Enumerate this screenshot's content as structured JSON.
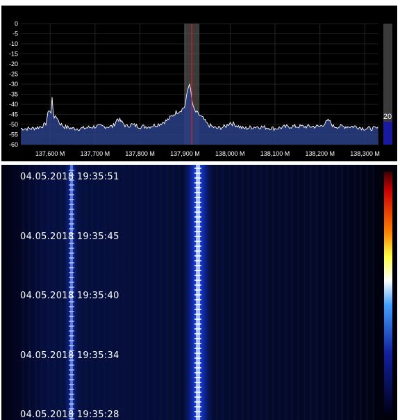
{
  "spectrum": {
    "y_axis_labels": [
      "0",
      "-5",
      "-10",
      "-15",
      "-20",
      "-25",
      "-30",
      "-35",
      "-40",
      "-45",
      "-50",
      "-55",
      "-60"
    ],
    "x_axis_labels": [
      "137,600 M",
      "137,700 M",
      "137,800 M",
      "137,900 M",
      "138,000 M",
      "138,100 M",
      "138,200 M",
      "138,300 M"
    ],
    "side_gain_value": "20",
    "colors": {
      "trace": "#ffffff",
      "fill": "#2a3f86",
      "marker": "#e02020",
      "bandwidth": "#6a6a6a",
      "grid": "#3c3c3c",
      "gain_bar": "#1a1aa0"
    }
  },
  "chart_data": {
    "type": "line",
    "title": "",
    "xlabel": "",
    "ylabel": "",
    "x_unit": "MHz",
    "xlim": [
      137.535,
      138.33
    ],
    "ylim": [
      -60,
      0
    ],
    "grid": true,
    "series": [
      {
        "x": [
          137.54,
          137.56,
          137.58,
          137.59,
          137.598,
          137.602,
          137.605,
          137.607,
          137.61,
          137.615,
          137.62,
          137.63,
          137.65,
          137.67,
          137.7,
          137.72,
          137.74,
          137.75,
          137.77,
          137.78,
          137.8,
          137.82,
          137.84,
          137.86,
          137.87,
          137.88,
          137.89,
          137.9,
          137.905,
          137.91,
          137.915,
          137.92,
          137.93,
          137.94,
          137.95,
          137.97,
          137.99,
          138.0,
          138.03,
          138.06,
          138.1,
          138.13,
          138.16,
          138.2,
          138.22,
          138.23,
          138.25,
          138.28,
          138.3,
          138.32
        ],
        "values": [
          -52,
          -52,
          -51,
          -50,
          -42,
          -45,
          -35,
          -44,
          -47,
          -46,
          -49,
          -51,
          -52,
          -52,
          -51,
          -51,
          -51,
          -47,
          -51,
          -50,
          -51,
          -51,
          -50,
          -48,
          -46,
          -44,
          -43,
          -41,
          -34,
          -29,
          -38,
          -43,
          -45,
          -47,
          -50,
          -52,
          -51,
          -49,
          -52,
          -51,
          -52,
          -51,
          -51,
          -51,
          -48,
          -51,
          -51,
          -51,
          -52,
          -52
        ]
      }
    ],
    "center_marker_mhz": 137.915
  },
  "waterfall": {
    "timestamps": [
      "04.05.2018 19:35:51",
      "04.05.2018 19:35:45",
      "04.05.2018 19:35:40",
      "04.05.2018 19:35:34",
      "04.05.2018 19:35:28"
    ]
  }
}
